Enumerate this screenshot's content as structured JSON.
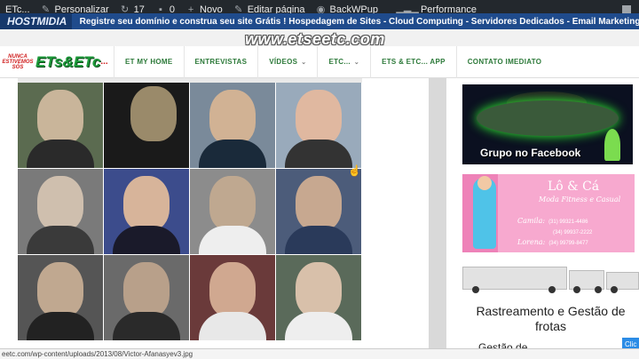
{
  "adminbar": {
    "site_label": "ETc...",
    "customize_label": "Personalizar",
    "updates_count": "17",
    "comments_count": "0",
    "new_label": "Novo",
    "edit_label": "Editar página",
    "backup_label": "BackWPup",
    "performance_label": "Performance"
  },
  "topstrip": {
    "host_logo": "HOSTMIDIA",
    "ticker": "Registre seu domínio e construa seu site Grátis ! Hospedagem de Sites - Cloud Computing - Servidores Dedicados - Email Marketing - Seja uma Revenda"
  },
  "site_url": "www.etseetc.com",
  "logo": {
    "small_text": "NUNCA ESTIVEMOS SÓS",
    "big_text": "ETs&ETc",
    "dots": "..."
  },
  "nav": {
    "items": [
      {
        "label": "ET MY HOME",
        "has_dropdown": false
      },
      {
        "label": "ENTREVISTAS",
        "has_dropdown": false
      },
      {
        "label": "VÍDEOS",
        "has_dropdown": true
      },
      {
        "label": "ETC...",
        "has_dropdown": true
      },
      {
        "label": "ETS & ETC... APP",
        "has_dropdown": false
      },
      {
        "label": "CONTATO IMEDIATO",
        "has_dropdown": false
      }
    ]
  },
  "sidebar": {
    "facebook_label": "Grupo no Facebook",
    "ad": {
      "title": "Lô & Cá",
      "subtitle": "Moda Fitness e Casual",
      "contact_1_name": "Camila:",
      "contact_1_phone": "(31) 99321-4486",
      "contact_2_phone": "(34) 99937-2222",
      "contact_3_name": "Lorena:",
      "contact_3_phone": "(34) 99799-8477"
    },
    "trucks_title_line1": "Rastreamento e Gestão de",
    "trucks_title_line2": "frotas",
    "gestao_label": "Gestão de",
    "click_button_label": "Clic"
  },
  "statusbar": {
    "url": "eetc.com/wp-content/uploads/2013/08/Victor-Afanasyev3.jpg"
  },
  "colors": {
    "adminbar_bg": "#23282d",
    "topstrip_bg": "#1f4b8c",
    "nav_text": "#2d7a3a",
    "ad_pink": "#ee82b8"
  },
  "grid_icons": [
    "portrait-image"
  ]
}
